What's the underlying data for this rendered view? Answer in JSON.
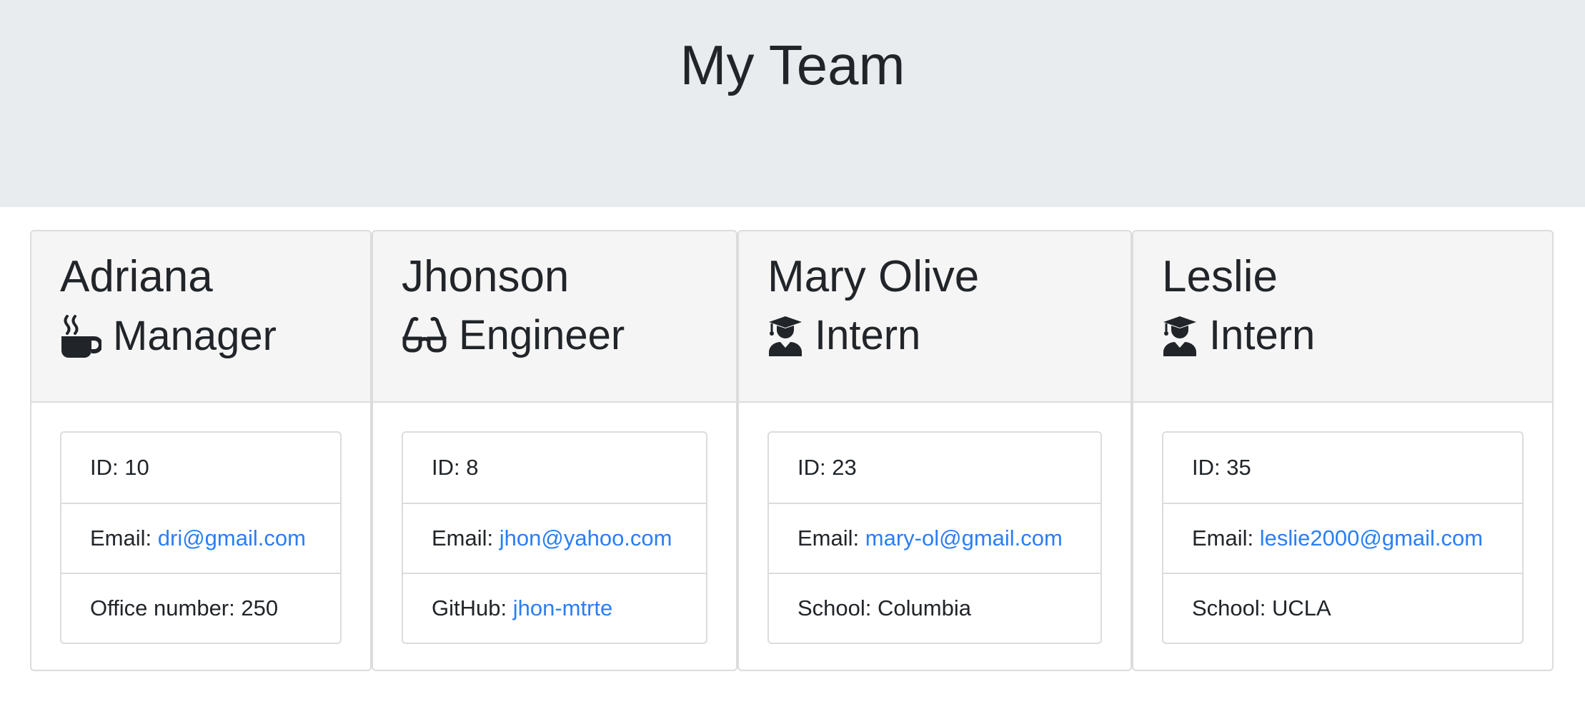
{
  "page": {
    "title": "My Team"
  },
  "team": [
    {
      "name": "Adriana",
      "role": "Manager",
      "icon": "coffee-icon",
      "id_label": "ID: 10",
      "email_prefix": "Email: ",
      "email": "dri@gmail.com",
      "extra_prefix": "Office number: 250",
      "extra_value": ""
    },
    {
      "name": "Jhonson",
      "role": "Engineer",
      "icon": "glasses-icon",
      "id_label": "ID: 8",
      "email_prefix": "Email: ",
      "email": "jhon@yahoo.com",
      "extra_prefix": "GitHub: ",
      "extra_value": "jhon-mtrte"
    },
    {
      "name": "Mary Olive",
      "role": "Intern",
      "icon": "graduate-icon",
      "id_label": "ID: 23",
      "email_prefix": "Email: ",
      "email": "mary-ol@gmail.com",
      "extra_prefix": "School: Columbia",
      "extra_value": ""
    },
    {
      "name": "Leslie",
      "role": "Intern",
      "icon": "graduate-icon",
      "id_label": "ID: 35",
      "email_prefix": "Email: ",
      "email": "leslie2000@gmail.com",
      "extra_prefix": "School: UCLA",
      "extra_value": ""
    }
  ],
  "colors": {
    "jumbotron": "#e9ecef",
    "card_header": "#f5f5f5",
    "link": "#2a7ef5",
    "text": "#212529"
  }
}
